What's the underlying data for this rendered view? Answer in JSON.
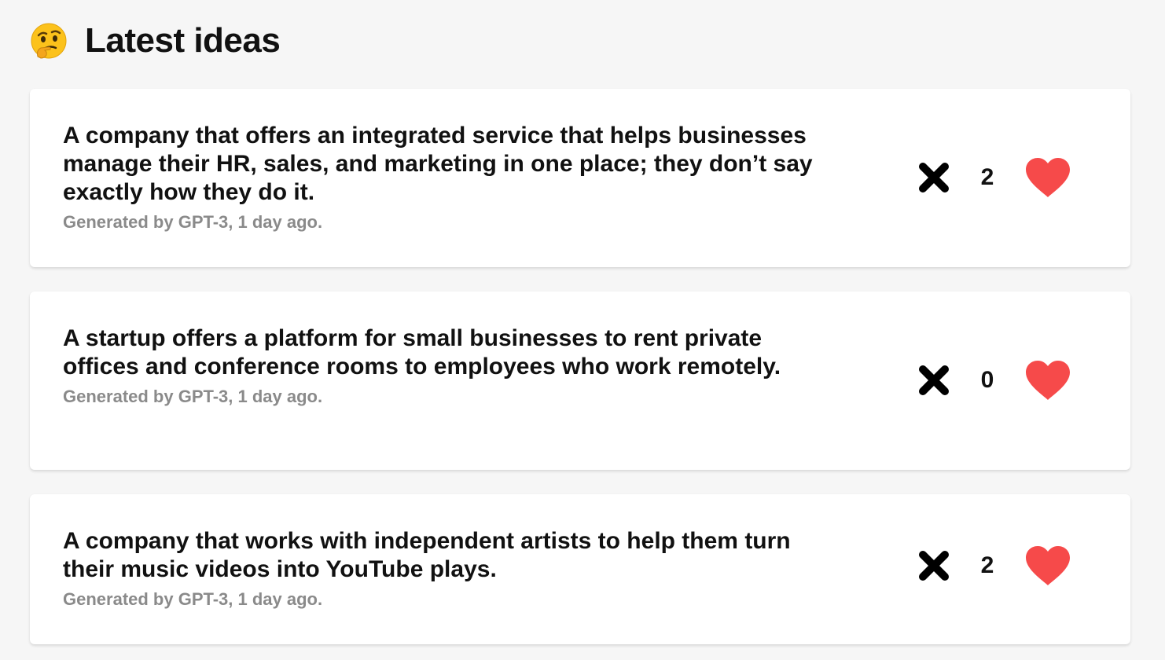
{
  "header": {
    "icon": "thinking-face-icon",
    "title": "Latest ideas"
  },
  "colors": {
    "background": "#f6f6f6",
    "card": "#ffffff",
    "heart": "#f64a4a",
    "meta": "#8a8a8a"
  },
  "ideas": [
    {
      "text": "A company that offers an integrated service that helps businesses manage their HR, sales, and marketing in one place; they don’t say exactly how they do it.",
      "meta": "Generated by GPT-3, 1 day ago.",
      "likes": "2",
      "dismiss_icon": "close-icon",
      "like_icon": "heart-icon"
    },
    {
      "text": "A startup offers a platform for small businesses to rent private offices and conference rooms to employees who work remotely.",
      "meta": "Generated by GPT-3, 1 day ago.",
      "likes": "0",
      "dismiss_icon": "close-icon",
      "like_icon": "heart-icon"
    },
    {
      "text": "A company that works with independent artists to help them turn their music videos into YouTube plays.",
      "meta": "Generated by GPT-3, 1 day ago.",
      "likes": "2",
      "dismiss_icon": "close-icon",
      "like_icon": "heart-icon"
    }
  ]
}
